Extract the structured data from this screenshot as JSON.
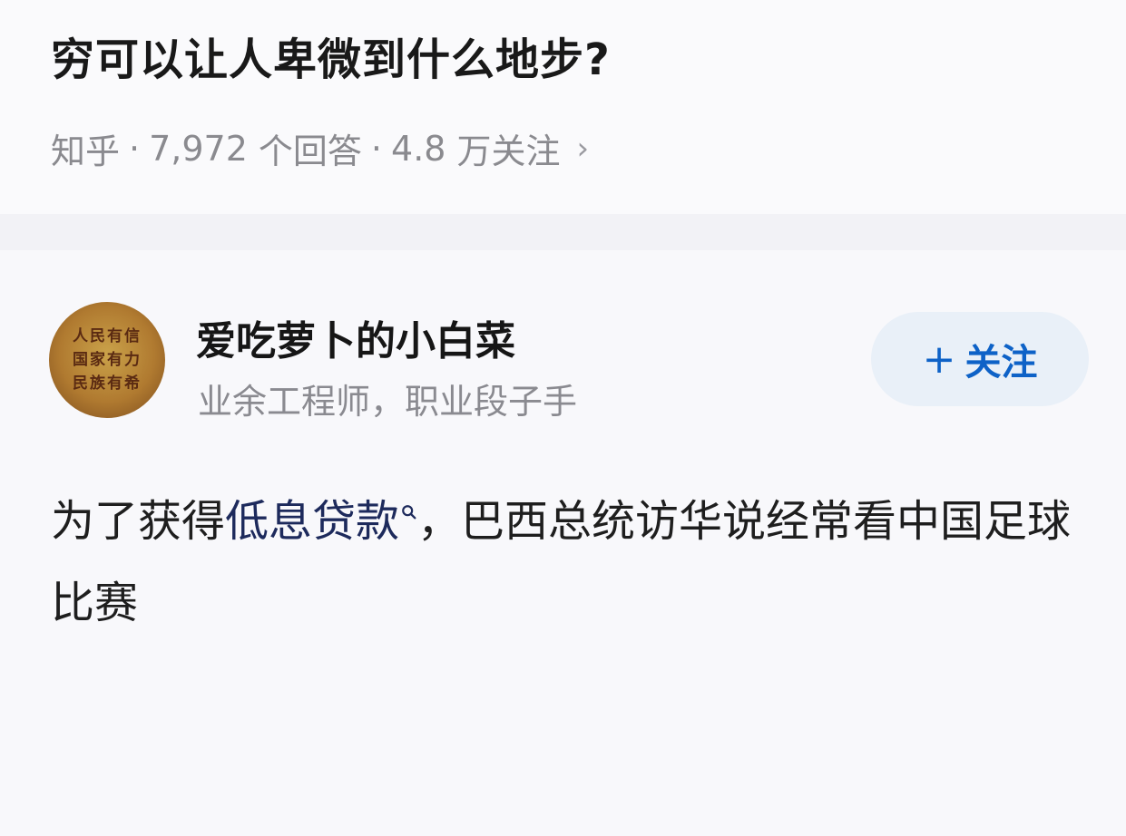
{
  "question": {
    "title": "穷可以让人卑微到什么地步?",
    "source": "知乎",
    "answer_count": "7,972",
    "answer_label": "个回答",
    "follower_count": "4.8",
    "follower_label": "万关注",
    "separator": "·",
    "chevron": "›"
  },
  "author": {
    "name": "爱吃萝卜的小白菜",
    "bio": "业余工程师，职业段子手",
    "avatar_lines": [
      "人民有信",
      "国家有力",
      "民族有希"
    ],
    "follow_plus": "+",
    "follow_label": "关注"
  },
  "answer": {
    "prefix": "为了获得",
    "keyword": "低息贷款",
    "rest": "，巴西总统访华说经常看中国足球比赛"
  },
  "colors": {
    "accent": "#0e62c7",
    "title_text": "#191919",
    "meta_text": "#8a8a8f",
    "follow_bg": "#e9f0f8"
  },
  "icons": {
    "meta_chevron": "chevron-right-icon",
    "keyword_search": "search-icon"
  }
}
